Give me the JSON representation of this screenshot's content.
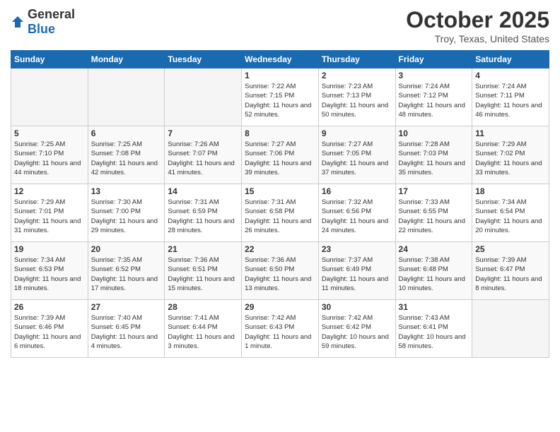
{
  "header": {
    "logo_general": "General",
    "logo_blue": "Blue",
    "month_title": "October 2025",
    "location": "Troy, Texas, United States"
  },
  "weekdays": [
    "Sunday",
    "Monday",
    "Tuesday",
    "Wednesday",
    "Thursday",
    "Friday",
    "Saturday"
  ],
  "weeks": [
    [
      {
        "day": "",
        "empty": true
      },
      {
        "day": "",
        "empty": true
      },
      {
        "day": "",
        "empty": true
      },
      {
        "day": "1",
        "sunrise": "7:22 AM",
        "sunset": "7:15 PM",
        "daylight": "11 hours and 52 minutes."
      },
      {
        "day": "2",
        "sunrise": "7:23 AM",
        "sunset": "7:13 PM",
        "daylight": "11 hours and 50 minutes."
      },
      {
        "day": "3",
        "sunrise": "7:24 AM",
        "sunset": "7:12 PM",
        "daylight": "11 hours and 48 minutes."
      },
      {
        "day": "4",
        "sunrise": "7:24 AM",
        "sunset": "7:11 PM",
        "daylight": "11 hours and 46 minutes."
      }
    ],
    [
      {
        "day": "5",
        "sunrise": "7:25 AM",
        "sunset": "7:10 PM",
        "daylight": "11 hours and 44 minutes."
      },
      {
        "day": "6",
        "sunrise": "7:25 AM",
        "sunset": "7:08 PM",
        "daylight": "11 hours and 42 minutes."
      },
      {
        "day": "7",
        "sunrise": "7:26 AM",
        "sunset": "7:07 PM",
        "daylight": "11 hours and 41 minutes."
      },
      {
        "day": "8",
        "sunrise": "7:27 AM",
        "sunset": "7:06 PM",
        "daylight": "11 hours and 39 minutes."
      },
      {
        "day": "9",
        "sunrise": "7:27 AM",
        "sunset": "7:05 PM",
        "daylight": "11 hours and 37 minutes."
      },
      {
        "day": "10",
        "sunrise": "7:28 AM",
        "sunset": "7:03 PM",
        "daylight": "11 hours and 35 minutes."
      },
      {
        "day": "11",
        "sunrise": "7:29 AM",
        "sunset": "7:02 PM",
        "daylight": "11 hours and 33 minutes."
      }
    ],
    [
      {
        "day": "12",
        "sunrise": "7:29 AM",
        "sunset": "7:01 PM",
        "daylight": "11 hours and 31 minutes."
      },
      {
        "day": "13",
        "sunrise": "7:30 AM",
        "sunset": "7:00 PM",
        "daylight": "11 hours and 29 minutes."
      },
      {
        "day": "14",
        "sunrise": "7:31 AM",
        "sunset": "6:59 PM",
        "daylight": "11 hours and 28 minutes."
      },
      {
        "day": "15",
        "sunrise": "7:31 AM",
        "sunset": "6:58 PM",
        "daylight": "11 hours and 26 minutes."
      },
      {
        "day": "16",
        "sunrise": "7:32 AM",
        "sunset": "6:56 PM",
        "daylight": "11 hours and 24 minutes."
      },
      {
        "day": "17",
        "sunrise": "7:33 AM",
        "sunset": "6:55 PM",
        "daylight": "11 hours and 22 minutes."
      },
      {
        "day": "18",
        "sunrise": "7:34 AM",
        "sunset": "6:54 PM",
        "daylight": "11 hours and 20 minutes."
      }
    ],
    [
      {
        "day": "19",
        "sunrise": "7:34 AM",
        "sunset": "6:53 PM",
        "daylight": "11 hours and 18 minutes."
      },
      {
        "day": "20",
        "sunrise": "7:35 AM",
        "sunset": "6:52 PM",
        "daylight": "11 hours and 17 minutes."
      },
      {
        "day": "21",
        "sunrise": "7:36 AM",
        "sunset": "6:51 PM",
        "daylight": "11 hours and 15 minutes."
      },
      {
        "day": "22",
        "sunrise": "7:36 AM",
        "sunset": "6:50 PM",
        "daylight": "11 hours and 13 minutes."
      },
      {
        "day": "23",
        "sunrise": "7:37 AM",
        "sunset": "6:49 PM",
        "daylight": "11 hours and 11 minutes."
      },
      {
        "day": "24",
        "sunrise": "7:38 AM",
        "sunset": "6:48 PM",
        "daylight": "11 hours and 10 minutes."
      },
      {
        "day": "25",
        "sunrise": "7:39 AM",
        "sunset": "6:47 PM",
        "daylight": "11 hours and 8 minutes."
      }
    ],
    [
      {
        "day": "26",
        "sunrise": "7:39 AM",
        "sunset": "6:46 PM",
        "daylight": "11 hours and 6 minutes."
      },
      {
        "day": "27",
        "sunrise": "7:40 AM",
        "sunset": "6:45 PM",
        "daylight": "11 hours and 4 minutes."
      },
      {
        "day": "28",
        "sunrise": "7:41 AM",
        "sunset": "6:44 PM",
        "daylight": "11 hours and 3 minutes."
      },
      {
        "day": "29",
        "sunrise": "7:42 AM",
        "sunset": "6:43 PM",
        "daylight": "11 hours and 1 minute."
      },
      {
        "day": "30",
        "sunrise": "7:42 AM",
        "sunset": "6:42 PM",
        "daylight": "10 hours and 59 minutes."
      },
      {
        "day": "31",
        "sunrise": "7:43 AM",
        "sunset": "6:41 PM",
        "daylight": "10 hours and 58 minutes."
      },
      {
        "day": "",
        "empty": true
      }
    ]
  ]
}
